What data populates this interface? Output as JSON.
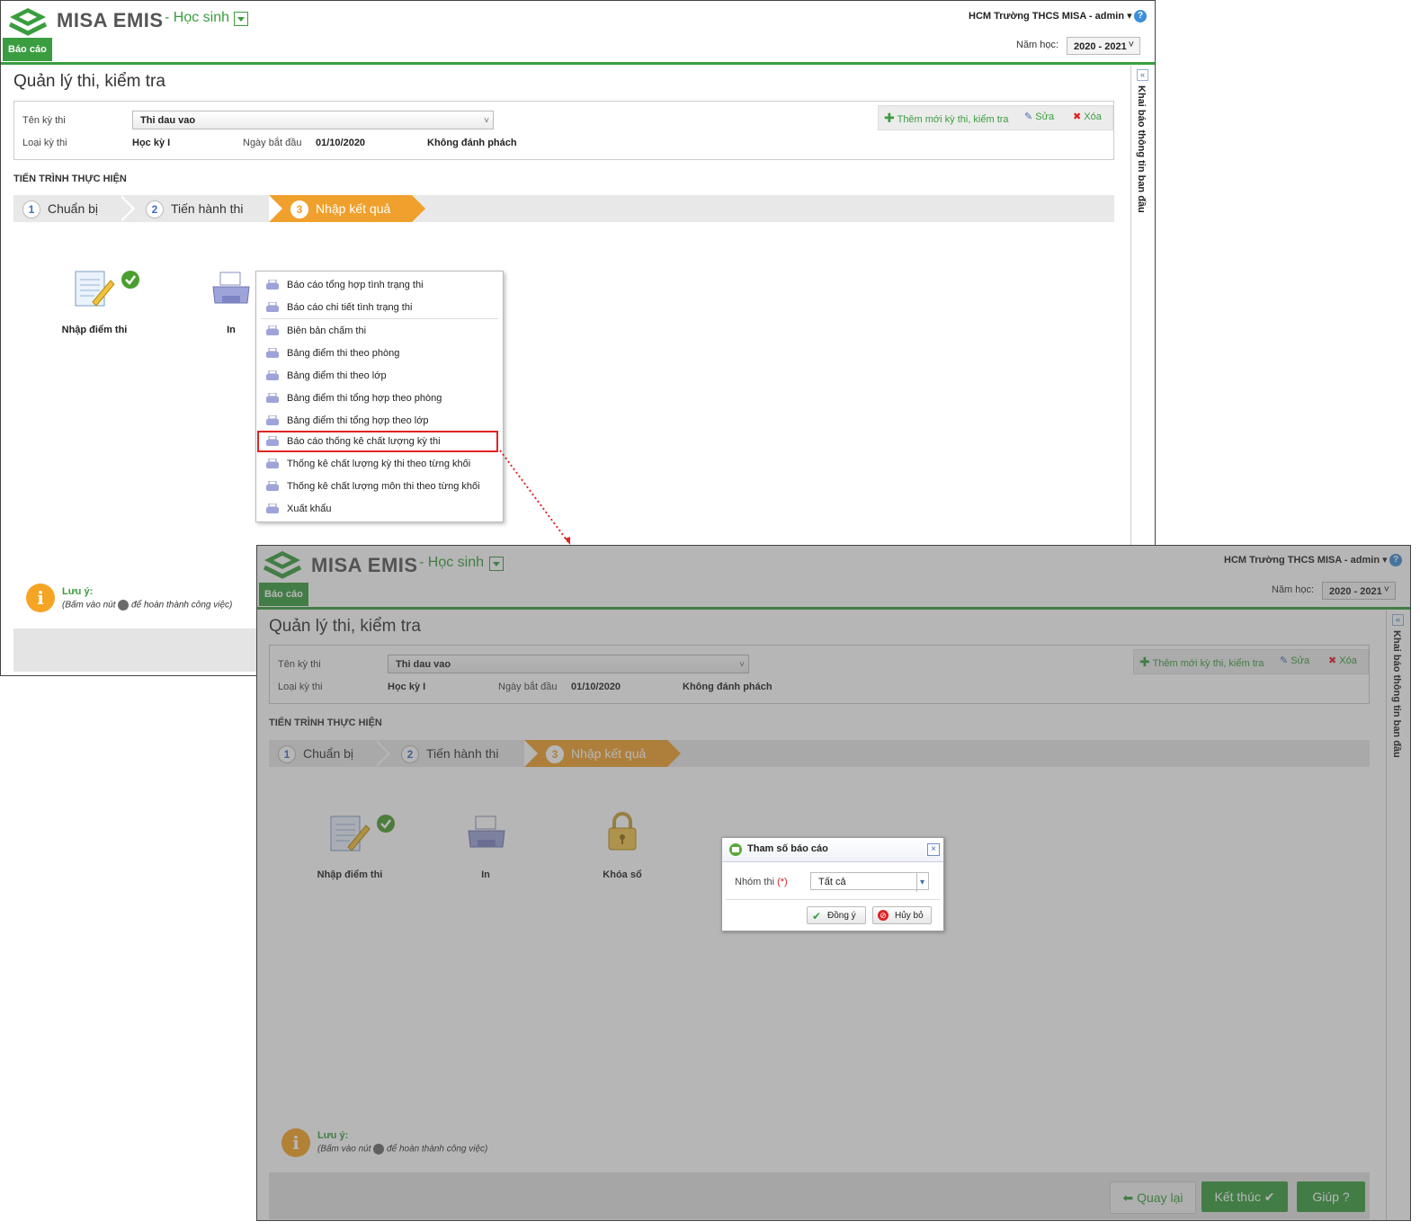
{
  "app": {
    "brand": "MISA EMIS",
    "module": "- Học sinh",
    "report_tab": "Báo cáo",
    "user": "HCM Trường THCS MISA - admin",
    "year_label": "Năm học:",
    "year_value": "2020 - 2021"
  },
  "page": {
    "title": "Quản lý thi, kiểm tra",
    "exam_name_label": "Tên kỳ thi",
    "exam_name_value": "Thi dau vao",
    "exam_type_label": "Loại kỳ thi",
    "exam_type_value": "Học kỳ I",
    "start_date_label": "Ngày bắt đầu",
    "start_date_value": "01/10/2020",
    "separator_value": "Không đánh phách",
    "toolbar": {
      "add": "Thêm mới kỳ thi, kiểm tra",
      "edit": "Sửa",
      "delete": "Xóa"
    },
    "section_title": "TIẾN TRÌNH THỰC HIỆN",
    "steps": [
      {
        "num": "1",
        "label": "Chuẩn bị"
      },
      {
        "num": "2",
        "label": "Tiến hành thi"
      },
      {
        "num": "3",
        "label": "Nhập kết quả"
      }
    ],
    "tiles": {
      "enter_scores": "Nhập điểm thi",
      "print": "In",
      "lock": "Khóa sổ"
    },
    "side_panel": "Khai báo thông tin ban đầu",
    "note_title": "Lưu ý:",
    "note_before": "(Bấm vào nút",
    "note_after": "để hoàn thành công việc)"
  },
  "print_menu": [
    "Báo cáo tổng hợp tình trạng thi",
    "Báo cáo chi tiết tình trạng thi",
    "Biên bản chấm thi",
    "Bảng điểm thi theo phòng",
    "Bảng điểm thi theo lớp",
    "Bảng điểm thi tổng hợp theo phòng",
    "Bảng điểm thi tổng hợp theo lớp",
    "Báo cáo thống kê chất lượng kỳ thi",
    "Thống kê chất lượng kỳ thi theo từng khối",
    "Thống kê chất lượng môn thi theo từng khối",
    "Xuất khẩu"
  ],
  "dialog": {
    "title": "Tham số báo cáo",
    "group_label": "Nhóm thi",
    "required_mark": "(*)",
    "group_value": "Tất cả",
    "ok": "Đồng ý",
    "cancel": "Hủy bỏ"
  },
  "footer": {
    "back": "Quay lại",
    "finish": "Kết thúc",
    "help": "Giúp"
  },
  "colors": {
    "brand_green": "#3a9d3f",
    "active_step": "#f0a02c",
    "highlight": "#e02424"
  }
}
